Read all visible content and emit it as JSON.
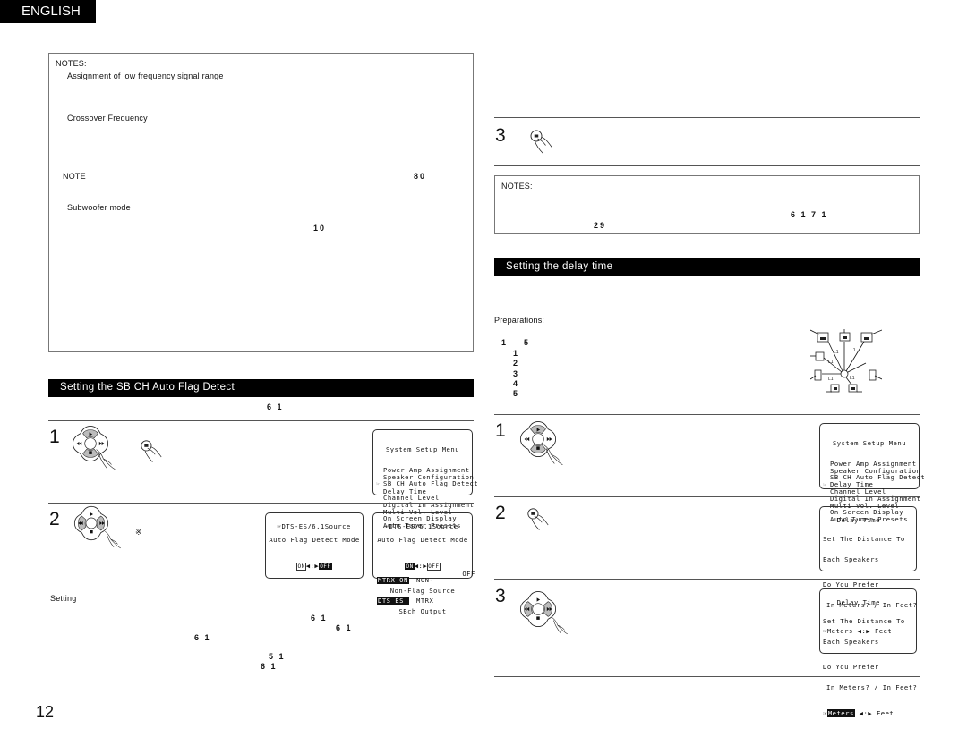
{
  "header": {
    "language_tab": "ENGLISH"
  },
  "left": {
    "notes_box": {
      "heading": "NOTES:",
      "item1": "Assignment of low frequency signal range",
      "item2": "Crossover Frequency",
      "note_label": "NOTE",
      "note_ref": "80",
      "item3": "Subwoofer mode",
      "item3_ref": "10"
    },
    "section_title": "Setting the SB CH Auto Flag Detect",
    "section_ref": "6 1",
    "step1": {
      "number": "1",
      "osd_title": "System Setup Menu",
      "osd_items": [
        "Power Amp Assignment",
        "Speaker Configuration",
        "SB CH Auto Flag Detect",
        "Delay Time",
        "Channel Level",
        "Digital In Assignment",
        "Multi Vol. Level",
        "On Screen Display",
        "Auto Tuner Presets"
      ],
      "osd_cursor": "☞",
      "osd_selected_index": 2
    },
    "step2": {
      "number": "2",
      "asterisk": "※",
      "osd_a": {
        "line1": "☞DTS-ES/6.1Source",
        "line2": "Auto Flag Detect Mode",
        "on": "ON",
        "arrows": "◀:▶",
        "off": "OFF",
        "selected": "OFF"
      },
      "osd_b": {
        "line1": "☞DTS-ES/6.1Source",
        "line2": "Auto Flag Detect Mode",
        "on": "ON",
        "arrows": "◀:▶",
        "off": "OFF",
        "selected": "ON",
        "line3": "Non-Flag Source",
        "line4": "SBch Output",
        "opt1a": "MTRX ON",
        "opt1b": "DTS ES",
        "opt2a": "NON-",
        "opt2b": "MTRX",
        "opt3": "OFF"
      }
    },
    "setting_label": "Setting",
    "refs": [
      "6 1",
      "6 1",
      "6 1",
      "5 1",
      "6 1"
    ],
    "footer_ref": "6 1"
  },
  "right": {
    "step3": {
      "number": "3"
    },
    "notes_box": {
      "heading": "NOTES:",
      "ref1": "6 1 7 1",
      "ref2": "29"
    },
    "section_title": "Setting the delay time",
    "preparations": {
      "label": "Preparations:",
      "range_start": "1",
      "range_end": "5",
      "items": [
        "1",
        "2",
        "3",
        "4",
        "5"
      ]
    },
    "diagram_labels": [
      "L1",
      "L1",
      "L1",
      "L1",
      "L1",
      "L1"
    ],
    "step1": {
      "number": "1",
      "osd_title": "System Setup Menu",
      "osd_items": [
        "Power Amp Assignment",
        "Speaker Configuration",
        "SB CH Auto Flag Detect",
        "Delay Time",
        "Channel Level",
        "Digital In Assignment",
        "Multi Vol. Level",
        "On Screen Display",
        "Auto Tuner Presets"
      ],
      "osd_cursor": "☞",
      "osd_selected_index": 3
    },
    "step2": {
      "number": "2",
      "osd": {
        "title": "Delay Time",
        "line1": "Set The Distance To",
        "line2": "Each Speakers",
        "line3": "Do You Prefer",
        "line4": "In Meters? / In Feet?",
        "cursor": "☞",
        "opt_meters": "Meters",
        "arrows": "◀:▶",
        "opt_feet": "Feet"
      }
    },
    "step3b": {
      "number": "3",
      "osd": {
        "title": "Delay Time",
        "line1": "Set The Distance To",
        "line2": "Each Speakers",
        "line3": "Do You Prefer",
        "line4": "In Meters? / In Feet?",
        "cursor": "☞",
        "opt_meters": "Meters",
        "arrows": "◀:▶",
        "opt_feet": "Feet",
        "selected": "Meters"
      }
    }
  },
  "footer": {
    "page_number": "12"
  }
}
